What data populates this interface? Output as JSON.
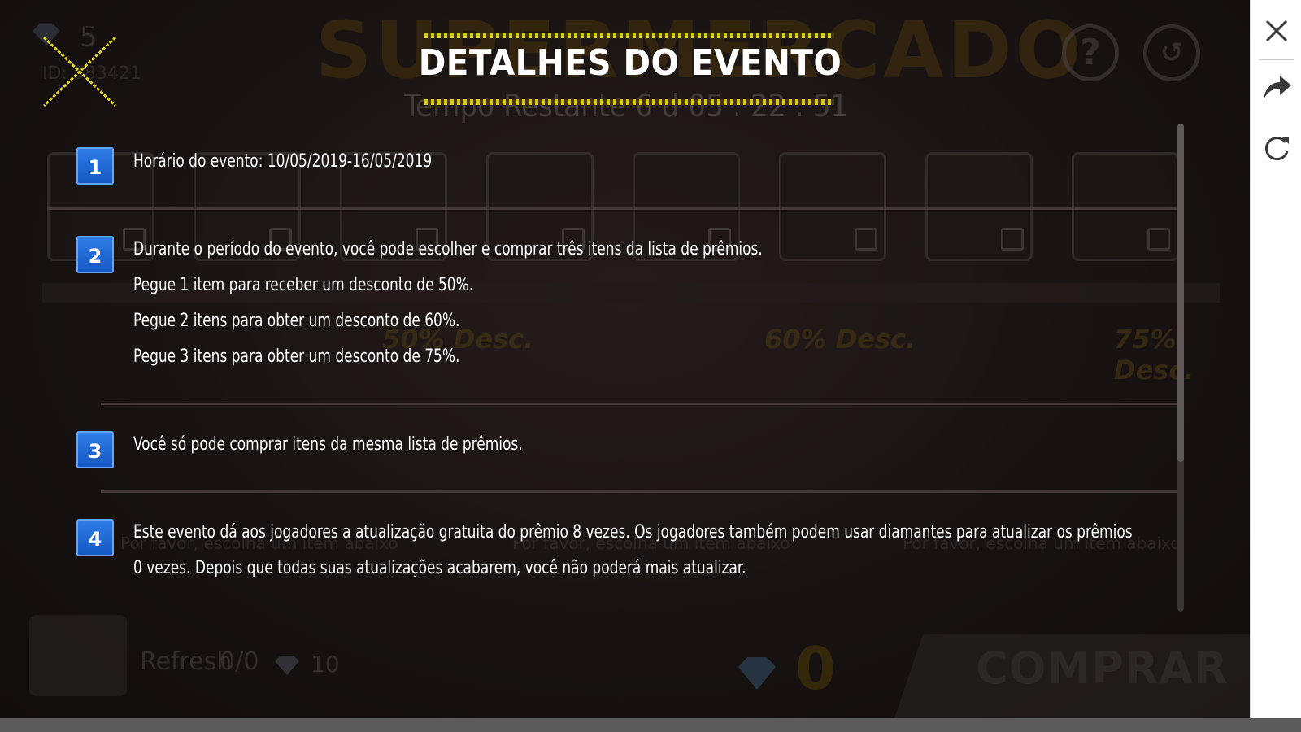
{
  "background": {
    "event_name": "SUPERMERCADO",
    "timer_text": "Tempo Restante 6 d 05 : 22 : 51",
    "player_id": "ID: 583421",
    "diamond_count": "5",
    "discount_labels": [
      "50% Desc.",
      "60% Desc.",
      "75% Desc."
    ],
    "select_prompt": "Por favor, escolha um item abaixo",
    "refresh_label": "Refresh",
    "refresh_count": "0/0",
    "refresh_cost": "10",
    "price_value": "0",
    "buy_label": "COMPRAR",
    "help_icon": "question-icon",
    "history_icon": "history-icon"
  },
  "dialog": {
    "title": "DETALHES DO EVENTO",
    "close_icon": "x-close-icon",
    "rules": [
      {
        "number": "1",
        "lines": [
          "Horário do evento: 10/05/2019-16/05/2019"
        ]
      },
      {
        "number": "2",
        "lines": [
          "Durante o período do evento, você pode escolher e comprar três itens da lista de prêmios.",
          "Pegue 1 item para receber um desconto de 50%.",
          "Pegue 2 itens para obter um desconto de 60%.",
          "Pegue 3 itens para obter um desconto de 75%."
        ]
      },
      {
        "number": "3",
        "lines": [
          "Você só pode comprar itens da mesma lista de prêmios."
        ]
      },
      {
        "number": "4",
        "lines": [
          "Este evento dá aos jogadores a atualização gratuita do prêmio 8 vezes. Os jogadores também podem usar diamantes para atualizar os prêmios",
          "0 vezes. Depois que todas suas atualizações acabarem, você não poderá mais atualizar."
        ]
      }
    ],
    "scroll_position": 0.0
  },
  "sidebar": {
    "close_icon": "close-icon",
    "share_icon": "share-arrow-icon",
    "refresh_icon": "reload-icon"
  },
  "colors": {
    "accent_yellow": "#d7c816",
    "rule_badge_blue": "#1f6ad6",
    "text": "#ffffff"
  }
}
